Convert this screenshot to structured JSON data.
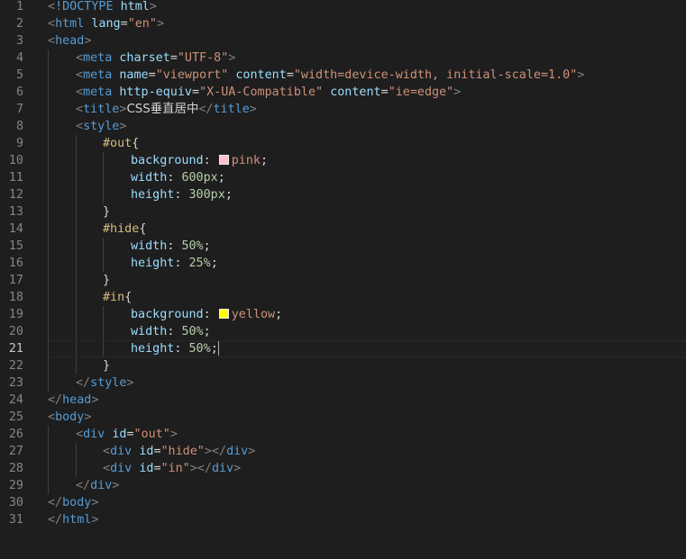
{
  "editor": {
    "current_line": 21,
    "colors": {
      "background": "#1e1e1e",
      "pink_swatch": "#ffc0cb",
      "yellow_swatch": "#ffff00"
    },
    "lines": [
      {
        "n": "1",
        "indent": 0,
        "tokens": [
          [
            "punc",
            "<"
          ],
          [
            "tag",
            "!DOCTYPE"
          ],
          [
            "text",
            " "
          ],
          [
            "attr",
            "html"
          ],
          [
            "punc",
            ">"
          ]
        ]
      },
      {
        "n": "2",
        "indent": 0,
        "tokens": [
          [
            "punc",
            "<"
          ],
          [
            "tag",
            "html"
          ],
          [
            "text",
            " "
          ],
          [
            "attr",
            "lang"
          ],
          [
            "text",
            "="
          ],
          [
            "str",
            "\"en\""
          ],
          [
            "punc",
            ">"
          ]
        ]
      },
      {
        "n": "3",
        "indent": 0,
        "tokens": [
          [
            "punc",
            "<"
          ],
          [
            "tag",
            "head"
          ],
          [
            "punc",
            ">"
          ]
        ]
      },
      {
        "n": "4",
        "indent": 1,
        "tokens": [
          [
            "punc",
            "<"
          ],
          [
            "tag",
            "meta"
          ],
          [
            "text",
            " "
          ],
          [
            "attr",
            "charset"
          ],
          [
            "text",
            "="
          ],
          [
            "str",
            "\"UTF-8\""
          ],
          [
            "punc",
            ">"
          ]
        ]
      },
      {
        "n": "5",
        "indent": 1,
        "tokens": [
          [
            "punc",
            "<"
          ],
          [
            "tag",
            "meta"
          ],
          [
            "text",
            " "
          ],
          [
            "attr",
            "name"
          ],
          [
            "text",
            "="
          ],
          [
            "str",
            "\"viewport\""
          ],
          [
            "text",
            " "
          ],
          [
            "attr",
            "content"
          ],
          [
            "text",
            "="
          ],
          [
            "str",
            "\"width=device-width, initial-scale=1.0\""
          ],
          [
            "punc",
            ">"
          ]
        ]
      },
      {
        "n": "6",
        "indent": 1,
        "tokens": [
          [
            "punc",
            "<"
          ],
          [
            "tag",
            "meta"
          ],
          [
            "text",
            " "
          ],
          [
            "attr",
            "http-equiv"
          ],
          [
            "text",
            "="
          ],
          [
            "str",
            "\"X-UA-Compatible\""
          ],
          [
            "text",
            " "
          ],
          [
            "attr",
            "content"
          ],
          [
            "text",
            "="
          ],
          [
            "str",
            "\"ie=edge\""
          ],
          [
            "punc",
            ">"
          ]
        ]
      },
      {
        "n": "7",
        "indent": 1,
        "tokens": [
          [
            "punc",
            "<"
          ],
          [
            "tag",
            "title"
          ],
          [
            "punc",
            ">"
          ],
          [
            "cjk",
            "CSS垂直居中"
          ],
          [
            "punc",
            "</"
          ],
          [
            "tag",
            "title"
          ],
          [
            "punc",
            ">"
          ]
        ]
      },
      {
        "n": "8",
        "indent": 1,
        "tokens": [
          [
            "punc",
            "<"
          ],
          [
            "tag",
            "style"
          ],
          [
            "punc",
            ">"
          ]
        ]
      },
      {
        "n": "9",
        "indent": 2,
        "tokens": [
          [
            "sel",
            "#out"
          ],
          [
            "text",
            "{"
          ]
        ]
      },
      {
        "n": "10",
        "indent": 3,
        "tokens": [
          [
            "prop",
            "background"
          ],
          [
            "text",
            ": "
          ],
          [
            "swatch",
            "pink_swatch"
          ],
          [
            "val",
            "pink"
          ],
          [
            "text",
            ";"
          ]
        ]
      },
      {
        "n": "11",
        "indent": 3,
        "tokens": [
          [
            "prop",
            "width"
          ],
          [
            "text",
            ": "
          ],
          [
            "num",
            "600px"
          ],
          [
            "text",
            ";"
          ]
        ]
      },
      {
        "n": "12",
        "indent": 3,
        "tokens": [
          [
            "prop",
            "height"
          ],
          [
            "text",
            ": "
          ],
          [
            "num",
            "300px"
          ],
          [
            "text",
            ";"
          ]
        ]
      },
      {
        "n": "13",
        "indent": 2,
        "tokens": [
          [
            "text",
            "}"
          ]
        ]
      },
      {
        "n": "14",
        "indent": 2,
        "tokens": [
          [
            "sel",
            "#hide"
          ],
          [
            "text",
            "{"
          ]
        ]
      },
      {
        "n": "15",
        "indent": 3,
        "tokens": [
          [
            "prop",
            "width"
          ],
          [
            "text",
            ": "
          ],
          [
            "num",
            "50%"
          ],
          [
            "text",
            ";"
          ]
        ]
      },
      {
        "n": "16",
        "indent": 3,
        "tokens": [
          [
            "prop",
            "height"
          ],
          [
            "text",
            ": "
          ],
          [
            "num",
            "25%"
          ],
          [
            "text",
            ";"
          ]
        ]
      },
      {
        "n": "17",
        "indent": 2,
        "tokens": [
          [
            "text",
            "}"
          ]
        ]
      },
      {
        "n": "18",
        "indent": 2,
        "tokens": [
          [
            "sel",
            "#in"
          ],
          [
            "text",
            "{"
          ]
        ]
      },
      {
        "n": "19",
        "indent": 3,
        "tokens": [
          [
            "prop",
            "background"
          ],
          [
            "text",
            ": "
          ],
          [
            "swatch",
            "yellow_swatch"
          ],
          [
            "val",
            "yellow"
          ],
          [
            "text",
            ";"
          ]
        ]
      },
      {
        "n": "20",
        "indent": 3,
        "tokens": [
          [
            "prop",
            "width"
          ],
          [
            "text",
            ": "
          ],
          [
            "num",
            "50%"
          ],
          [
            "text",
            ";"
          ]
        ]
      },
      {
        "n": "21",
        "indent": 3,
        "tokens": [
          [
            "prop",
            "height"
          ],
          [
            "text",
            ": "
          ],
          [
            "num",
            "50%"
          ],
          [
            "text",
            ";"
          ],
          [
            "cursor",
            ""
          ]
        ]
      },
      {
        "n": "22",
        "indent": 2,
        "tokens": [
          [
            "text",
            "}"
          ]
        ]
      },
      {
        "n": "23",
        "indent": 1,
        "tokens": [
          [
            "punc",
            "</"
          ],
          [
            "tag",
            "style"
          ],
          [
            "punc",
            ">"
          ]
        ]
      },
      {
        "n": "24",
        "indent": 0,
        "tokens": [
          [
            "punc",
            "</"
          ],
          [
            "tag",
            "head"
          ],
          [
            "punc",
            ">"
          ]
        ]
      },
      {
        "n": "25",
        "indent": 0,
        "tokens": [
          [
            "punc",
            "<"
          ],
          [
            "tag",
            "body"
          ],
          [
            "punc",
            ">"
          ]
        ]
      },
      {
        "n": "26",
        "indent": 1,
        "tokens": [
          [
            "punc",
            "<"
          ],
          [
            "tag",
            "div"
          ],
          [
            "text",
            " "
          ],
          [
            "attr",
            "id"
          ],
          [
            "text",
            "="
          ],
          [
            "str",
            "\"out\""
          ],
          [
            "punc",
            ">"
          ]
        ]
      },
      {
        "n": "27",
        "indent": 2,
        "tokens": [
          [
            "punc",
            "<"
          ],
          [
            "tag",
            "div"
          ],
          [
            "text",
            " "
          ],
          [
            "attr",
            "id"
          ],
          [
            "text",
            "="
          ],
          [
            "str",
            "\"hide\""
          ],
          [
            "punc",
            "></"
          ],
          [
            "tag",
            "div"
          ],
          [
            "punc",
            ">"
          ]
        ]
      },
      {
        "n": "28",
        "indent": 2,
        "tokens": [
          [
            "punc",
            "<"
          ],
          [
            "tag",
            "div"
          ],
          [
            "text",
            " "
          ],
          [
            "attr",
            "id"
          ],
          [
            "text",
            "="
          ],
          [
            "str",
            "\"in\""
          ],
          [
            "punc",
            "></"
          ],
          [
            "tag",
            "div"
          ],
          [
            "punc",
            ">"
          ]
        ]
      },
      {
        "n": "29",
        "indent": 1,
        "tokens": [
          [
            "punc",
            "</"
          ],
          [
            "tag",
            "div"
          ],
          [
            "punc",
            ">"
          ]
        ]
      },
      {
        "n": "30",
        "indent": 0,
        "tokens": [
          [
            "punc",
            "</"
          ],
          [
            "tag",
            "body"
          ],
          [
            "punc",
            ">"
          ]
        ]
      },
      {
        "n": "31",
        "indent": 0,
        "tokens": [
          [
            "punc",
            "</"
          ],
          [
            "tag",
            "html"
          ],
          [
            "punc",
            ">"
          ]
        ]
      }
    ]
  }
}
